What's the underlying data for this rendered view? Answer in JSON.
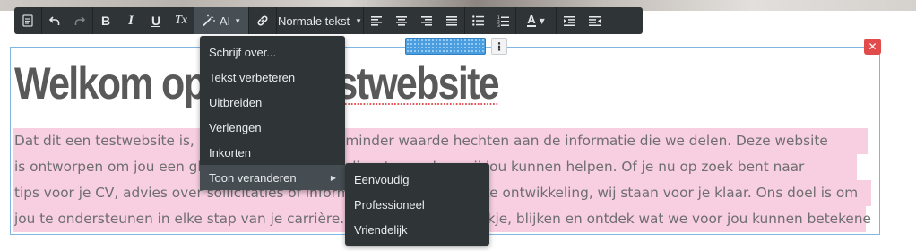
{
  "colors": {
    "toolbar_bg": "#2f3437",
    "menu_bg": "#2f3437",
    "selection_highlight": "#f8cfe1",
    "close_button": "#e24b4b",
    "drag_handle": "#4a9ee0",
    "editor_border": "#7fb6e3",
    "text": "#6e6e6e"
  },
  "toolbar": {
    "ai_label": "AI",
    "format_label": "Normale tekst",
    "icons": [
      "document-icon",
      "undo-icon",
      "redo-icon",
      "bold-icon",
      "italic-icon",
      "underline-icon",
      "clear-format-icon",
      "magic-wand-icon",
      "link-icon",
      "align-left-icon",
      "align-center-icon",
      "align-right-icon",
      "align-justify-icon",
      "bullet-list-icon",
      "numbered-list-icon",
      "text-color-icon",
      "indent-icon",
      "outdent-icon"
    ],
    "bold_glyph": "B",
    "italic_glyph": "I",
    "underline_glyph": "U",
    "clear_glyph": "Tx",
    "color_glyph": "A"
  },
  "content": {
    "heading": "Welkom op onze testwebsite",
    "heading_prefix": "Welkom op onze ",
    "heading_spell": "testwebsite",
    "paragraph_lines": [
      "Dat dit een testwebsite is, betekent niet dat we minder waarde hechten aan de informatie die we delen. Deze website",
      "is ontworpen om jou een glimp te geven van de diensten en hoe wij jou kunnen helpen. Of je nu op zoek bent naar",
      "tips voor je CV, advies over sollicitaties of informatie over persoonlijke ontwikkeling, wij staan voor je klaar. Ons doel is om",
      "jou te ondersteunen in elke stap van je carrière. Neem gerust een kijkje, blijken en ontdek wat we voor jou kunnen betekenen!"
    ]
  },
  "ai_menu": {
    "items": [
      {
        "label": "Schrijf over..."
      },
      {
        "label": "Tekst verbeteren"
      },
      {
        "label": "Uitbreiden"
      },
      {
        "label": "Verlengen"
      },
      {
        "label": "Inkorten"
      },
      {
        "label": "Toon veranderen",
        "has_submenu": true
      }
    ]
  },
  "tone_menu": {
    "items": [
      {
        "label": "Eenvoudig"
      },
      {
        "label": "Professioneel"
      },
      {
        "label": "Vriendelijk"
      }
    ]
  },
  "block_controls": {
    "close_glyph": "✕",
    "more_glyph": "⋮"
  }
}
